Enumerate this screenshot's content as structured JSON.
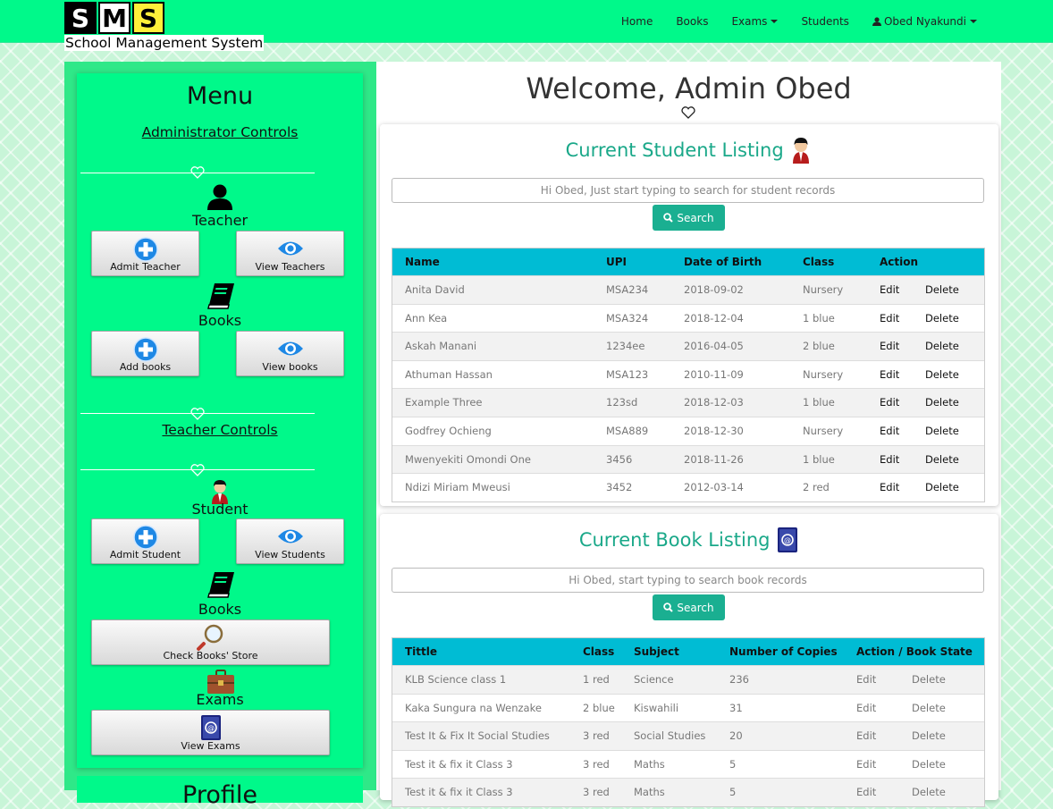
{
  "brand": {
    "letters": [
      "S",
      "M",
      "S"
    ],
    "subtitle": "School Management System"
  },
  "nav": {
    "home": "Home",
    "books": "Books",
    "exams": "Exams",
    "students": "Students",
    "user": "Obed Nyakundi"
  },
  "sidebar": {
    "title": "Menu",
    "admin_controls": "Administrator Controls",
    "teacher_section": "Teacher",
    "admit_teacher": "Admit Teacher",
    "view_teachers": "View Teachers",
    "books_section_1": "Books",
    "add_books": "Add books",
    "view_books": "View books",
    "teacher_controls": "Teacher Controls",
    "student_section": "Student",
    "admit_student": "Admit Student",
    "view_students": "View Students",
    "books_section_2": "Books",
    "check_books_store": "Check Books' Store",
    "exams_section": "Exams",
    "view_exams": "View Exams",
    "next_card_title": "Profile"
  },
  "main": {
    "welcome": "Welcome, Admin Obed",
    "students": {
      "title": "Current Student Listing",
      "search_placeholder": "Hi Obed, Just start typing to search for student records",
      "search_button": "Search",
      "columns": [
        "Name",
        "UPI",
        "Date of Birth",
        "Class",
        "Action"
      ],
      "rows": [
        [
          "Anita David",
          "MSA234",
          "2018-09-02",
          "Nursery"
        ],
        [
          "Ann Kea",
          "MSA324",
          "2018-12-04",
          "1 blue"
        ],
        [
          "Askah Manani",
          "1234ee",
          "2016-04-05",
          "2 blue"
        ],
        [
          "Athuman Hassan",
          "MSA123",
          "2010-11-09",
          "Nursery"
        ],
        [
          "Example Three",
          "123sd",
          "2018-12-03",
          "1 blue"
        ],
        [
          "Godfrey Ochieng",
          "MSA889",
          "2018-12-30",
          "Nursery"
        ],
        [
          "Mwenyekiti Omondi One",
          "3456",
          "2018-11-26",
          "1 blue"
        ],
        [
          "Ndizi Miriam Mweusi",
          "3452",
          "2012-03-14",
          "2 red"
        ]
      ],
      "edit": "Edit",
      "delete": "Delete"
    },
    "books": {
      "title": "Current Book Listing",
      "search_placeholder": "Hi Obed, start typing to search book records",
      "search_button": "Search",
      "columns": [
        "Tittle",
        "Class",
        "Subject",
        "Number of Copies",
        "Action / Book State"
      ],
      "rows": [
        [
          "KLB Science class 1",
          "1 red",
          "Science",
          "236"
        ],
        [
          "Kaka Sungura na Wenzake",
          "2 blue",
          "Kiswahili",
          "31"
        ],
        [
          "Test It & Fix It Social Studies",
          "3 red",
          "Social Studies",
          "20"
        ],
        [
          "Test it & fix it Class 3",
          "3 red",
          "Maths",
          "5"
        ],
        [
          "Test it & fix it Class 3",
          "3 red",
          "Maths",
          "5"
        ]
      ],
      "edit": "Edit",
      "delete": "Delete"
    }
  },
  "colors": {
    "navbar": "#00f98a",
    "table_header": "#00bcd4",
    "accent": "#1aaf91"
  }
}
